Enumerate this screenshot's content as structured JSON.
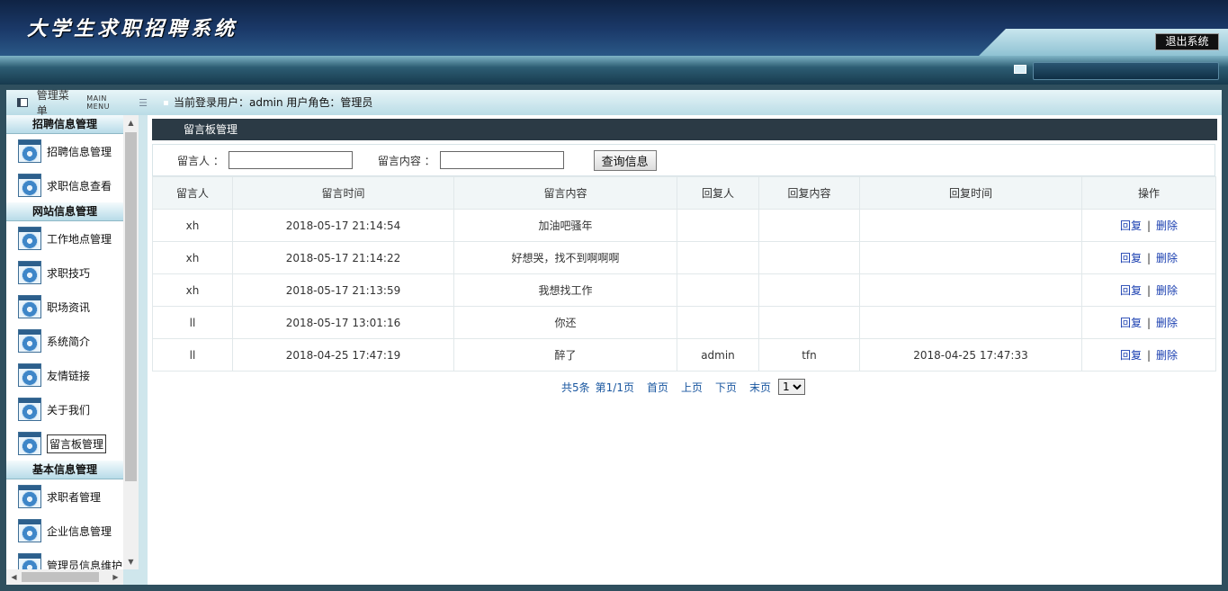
{
  "header": {
    "title": "大学生求职招聘系统",
    "logout_label": "退出系统"
  },
  "menu": {
    "title": "管理菜单",
    "subtitle_en": "MAIN MENU"
  },
  "login_info": "当前登录用户：admin  用户角色：管理员",
  "sidebar": {
    "groups": [
      {
        "title": "招聘信息管理",
        "items": [
          "招聘信息管理",
          "求职信息查看"
        ]
      },
      {
        "title": "网站信息管理",
        "items": [
          "工作地点管理",
          "求职技巧",
          "职场资讯",
          "系统简介",
          "友情链接",
          "关于我们",
          "留言板管理"
        ]
      },
      {
        "title": "基本信息管理",
        "items": [
          "求职者管理",
          "企业信息管理",
          "管理员信息维护"
        ]
      }
    ],
    "active_item": "留言板管理"
  },
  "panel": {
    "title": "留言板管理"
  },
  "search": {
    "author_label": "留言人 ：",
    "author_value": "",
    "content_label": "留言内容 ：",
    "content_value": "",
    "button_label": "查询信息"
  },
  "table": {
    "columns": [
      "留言人",
      "留言时间",
      "留言内容",
      "回复人",
      "回复内容",
      "回复时间",
      "操作"
    ],
    "rows": [
      {
        "author": "xh",
        "time": "2018-05-17 21:14:54",
        "content": "加油吧骚年",
        "replier": "",
        "reply": "",
        "reply_time": ""
      },
      {
        "author": "xh",
        "time": "2018-05-17 21:14:22",
        "content": "好想哭，找不到啊啊啊",
        "replier": "",
        "reply": "",
        "reply_time": ""
      },
      {
        "author": "xh",
        "time": "2018-05-17 21:13:59",
        "content": "我想找工作",
        "replier": "",
        "reply": "",
        "reply_time": ""
      },
      {
        "author": "ll",
        "time": "2018-05-17 13:01:16",
        "content": "你还",
        "replier": "",
        "reply": "",
        "reply_time": ""
      },
      {
        "author": "ll",
        "time": "2018-04-25 17:47:19",
        "content": "醉了",
        "replier": "admin",
        "reply": "tfn",
        "reply_time": "2018-04-25 17:47:33"
      }
    ],
    "action_reply": "回复",
    "action_separator": "|",
    "action_delete": "删除"
  },
  "pager": {
    "total": "共5条",
    "page_info": "第1/1页",
    "first": "首页",
    "prev": "上页",
    "next": "下页",
    "last": "末页",
    "selected_page": "1"
  }
}
